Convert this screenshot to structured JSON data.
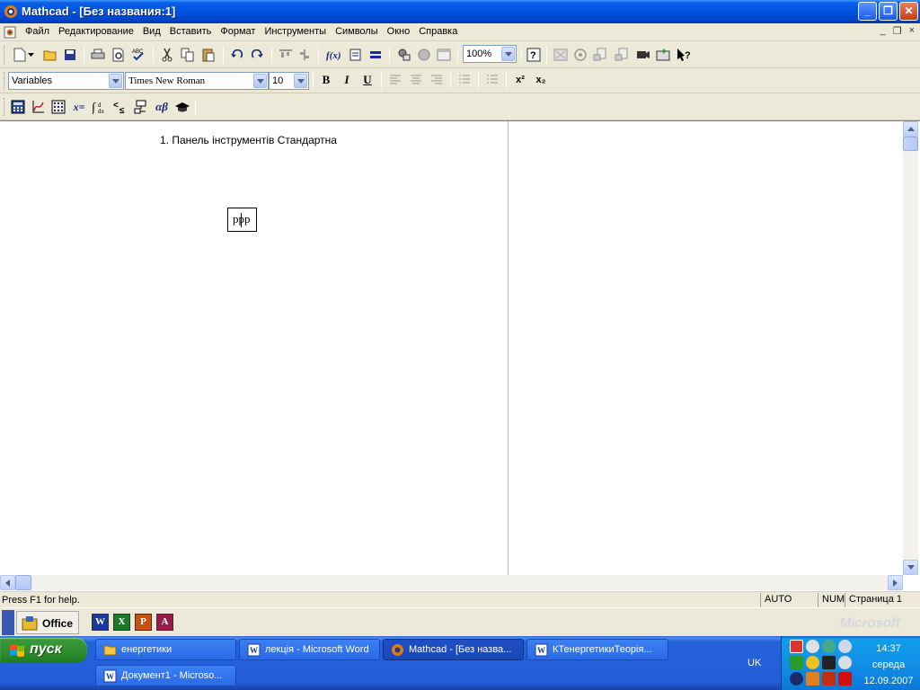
{
  "window": {
    "title": "Mathcad - [Без названия:1]",
    "minimize_glyph": "_",
    "restore_glyph": "❐",
    "close_glyph": "✕"
  },
  "menu": {
    "items": [
      "Файл",
      "Редактирование",
      "Вид",
      "Вставить",
      "Формат",
      "Инструменты",
      "Символы",
      "Окно",
      "Справка"
    ],
    "mdi_min": "_",
    "mdi_restore": "❐",
    "mdi_close": "×"
  },
  "toolbar": {
    "zoom_value": "100%"
  },
  "format_toolbar": {
    "style_value": "Variables",
    "font_value": "Times New Roman",
    "size_value": "10",
    "bold_label": "B",
    "italic_label": "I",
    "underline_label": "U",
    "superscript_label": "x²",
    "subscript_label": "x₂"
  },
  "math_toolbar": {
    "eval_label": "x=",
    "greek_label": "αβ"
  },
  "document": {
    "heading": "1. Панель інструментів Стандартна",
    "region_text": "ppp"
  },
  "status": {
    "help": "Press F1 for help.",
    "auto": "AUTO",
    "num": "NUM",
    "page": "Страница 1"
  },
  "office_bar": {
    "label": "Office",
    "watermark": "Microsoft",
    "apps": [
      "W",
      "X",
      "P",
      "A"
    ]
  },
  "taskbar": {
    "start_label": "пуск",
    "tasks": [
      {
        "label": "енергетики"
      },
      {
        "label": "лекція - Microsoft Word"
      },
      {
        "label": "Mathcad - [Без назва..."
      },
      {
        "label": "КТенергетикиТеорія..."
      },
      {
        "label": "Документ1 - Microso..."
      }
    ],
    "language": "UK",
    "time": "14:37",
    "day": "середа",
    "date": "12.09.2007"
  },
  "colors": {
    "titlebar": "#0054e3",
    "taskbar": "#245edb",
    "start": "#2f8f2f",
    "tray": "#1090e7"
  }
}
